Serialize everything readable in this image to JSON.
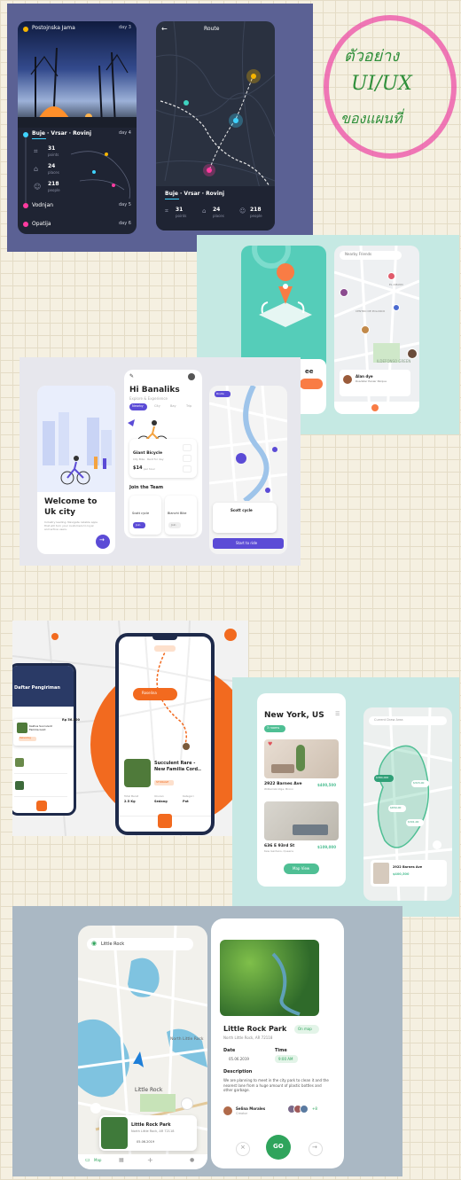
{
  "note": {
    "line1": "ตัวอย่าง",
    "line2": "UI/UX",
    "line3": "ของแผนที่"
  },
  "p1": {
    "left": {
      "title": "Postojnska Jama",
      "day_top": "day 3",
      "route": "Buje · Vrsar · Rovinj",
      "day4": "day 4",
      "stats": [
        {
          "value": "31",
          "unit": "points"
        },
        {
          "value": "24",
          "unit": "places"
        },
        {
          "value": "218",
          "unit": "people"
        }
      ],
      "stops": [
        {
          "name": "Vodnjan",
          "day": "day 5"
        },
        {
          "name": "Opatija",
          "day": "day 6"
        }
      ]
    },
    "right": {
      "title": "Route",
      "route": "Buje · Vrsar · Rovinj",
      "stats": [
        {
          "value": "31",
          "unit": "points"
        },
        {
          "value": "24",
          "unit": "places"
        },
        {
          "value": "218",
          "unit": "people"
        }
      ]
    }
  },
  "p2": {
    "search": "Nearby Friends",
    "card_title": "Alan dye",
    "card_sub": "Roadster Panier Parque",
    "labels": [
      "EL AMANO",
      "ILDEFONSO GREEN",
      "CENTRO DE POLANCO"
    ],
    "teaser": "ee"
  },
  "p3": {
    "welcome1": "Welcome to",
    "welcome2": "Uk city",
    "welcome_body": "Industry leading. Navigate reliable apps that will turn your customers to loyal and active users.",
    "greet": "Hi Banaliks",
    "greet_sub": "Explore & Experience",
    "tabs": [
      "Nearby",
      "City",
      "Bay",
      "Trip"
    ],
    "bike": "Giant Bicycle",
    "bike_sub": "City Bike · Rent for day",
    "price": "$14",
    "price_unit": "per hour",
    "join": "Join the Team",
    "cards": [
      {
        "name": "Scott cycle",
        "btn": "Join"
      },
      {
        "name": "Bianchi Bike",
        "btn": "Join"
      }
    ],
    "map_tag": "Route",
    "scott": "Scott cycle",
    "start": "Start to ride"
  },
  "p4": {
    "header": "Daftar Pengiriman",
    "plant": "Succulent Rare - New Familia Cord..",
    "plant_tag": "STORAGE",
    "order_title": "Kaktus Succulent Familia Gold",
    "order_price": "Rp 56.800",
    "badge": "Delivering",
    "cols": [
      "Total Berat",
      "Ukuran",
      "Kategori"
    ],
    "vals": [
      "2.5 Kg",
      "Sedang",
      "Pot"
    ],
    "pin": "Roselina"
  },
  "p5": {
    "city": "New York, US",
    "chip": "3 rooms",
    "a1": "2922 Barnes Ave",
    "a1_sub": "Williamsbridge, Bronx",
    "a1_price": "$400,500",
    "a2": "636 E 93rd St",
    "a2_sub": "Kew Gardens, Queens",
    "a2_price": "$109,000",
    "map_btn": "Map View",
    "search": "Current Draw Area",
    "prices": [
      "$384,000",
      "$315,00",
      "$650,00",
      "$301,00"
    ],
    "card": "2922 Barnes Ave",
    "card_price": "$400,500"
  },
  "p6": {
    "search": "Little Rock",
    "map_city": "North Little Rock",
    "map_label": "Little Rock",
    "place": "Little Rock Park",
    "addr": "North Little Rock, AR 72118",
    "date": "05.06.2019",
    "detail_title": "Little Rock Park",
    "detail_addr": "North Little Rock, AR 72118",
    "chip": "On map",
    "date_label": "Date",
    "time_label": "Time",
    "time": "9:00 AM",
    "desc_title": "Description",
    "desc": "We are planning to meet in the city park to clean it and the nearest lane from a huge amount of plastic bottles and other garbage.",
    "person": "Selina Morales",
    "person_role": "Creator",
    "extra": "+8",
    "go": "GO",
    "nav": "Map"
  }
}
